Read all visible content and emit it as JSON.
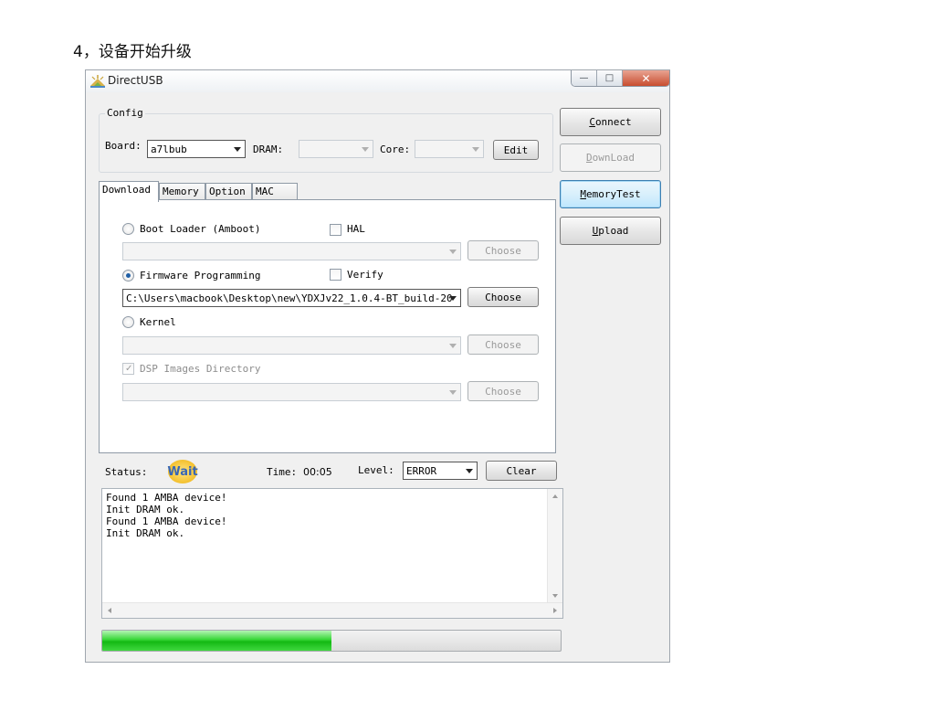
{
  "page_heading": "4，设备开始升级",
  "window": {
    "title": "DirectUSB",
    "controls": {
      "minimize": "—",
      "maximize": "□",
      "close": "✕"
    }
  },
  "config": {
    "legend": "Config",
    "board_label": "Board:",
    "board_value": "a7lbub",
    "dram_label": "DRAM:",
    "dram_value": "",
    "core_label": "Core:",
    "core_value": "",
    "edit_button": "Edit"
  },
  "side_buttons": {
    "connect": {
      "first": "C",
      "rest": "onnect"
    },
    "download": {
      "first": "D",
      "rest": "ownLoad"
    },
    "memory_test": {
      "first": "M",
      "rest": "emoryTest"
    },
    "upload": {
      "first": "U",
      "rest": "pload"
    }
  },
  "tabs": [
    "Download",
    "Memory",
    "Option",
    "MAC"
  ],
  "download_tab": {
    "boot_loader_label": "Boot Loader (Amboot)",
    "hal_label": "HAL",
    "boot_loader_path": "",
    "firmware_label": "Firmware Programming",
    "verify_label": "Verify",
    "firmware_path": "C:\\Users\\macbook\\Desktop\\new\\YDXJv22_1.0.4-BT_build-20",
    "kernel_label": "Kernel",
    "kernel_path": "",
    "dsp_label": "DSP Images Directory",
    "dsp_path": "",
    "choose_label": "Choose"
  },
  "status_bar": {
    "status_label": "Status:",
    "wait_badge": "Wait",
    "time_label": "Time:",
    "time_value": "00:05",
    "level_label": "Level:",
    "level_value": "ERROR",
    "clear_button": "Clear"
  },
  "log_lines": [
    "Found 1 AMBA device!",
    "Init DRAM ok.",
    "Found 1 AMBA device!",
    "Init DRAM ok."
  ],
  "progress": {
    "fraction": 0.5
  },
  "colors": {
    "progress_green": "#13b913",
    "focus_blue": "#3c7fb1",
    "close_red": "#c84d2f"
  }
}
